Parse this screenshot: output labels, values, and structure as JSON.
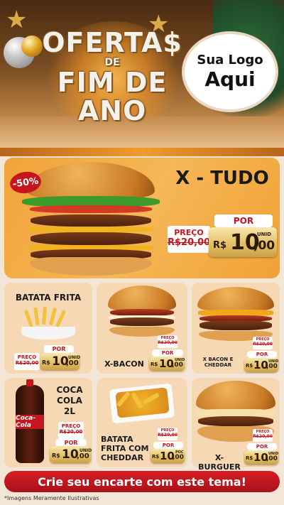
{
  "header": {
    "title_line1": "OFERTA$",
    "title_line2": "DE",
    "title_line3": "FIM DE ANO",
    "logo_line1": "Sua Logo",
    "logo_line2": "Aqui"
  },
  "currency": "R$",
  "unit_label": "UNID",
  "por_label": "POR",
  "preco_label": "PREÇO",
  "featured": {
    "name": "X - TUDO",
    "discount": "-50%",
    "old_price": "R$20,00",
    "price_int": "10",
    "price_dec": ",00"
  },
  "products": [
    {
      "name": "BATATA FRITA",
      "old_price": "R$20,00",
      "price_int": "10",
      "price_dec": ",00"
    },
    {
      "name": "X-BACON",
      "old_price": "R$20,00",
      "price_int": "10",
      "price_dec": ",00"
    },
    {
      "name": "X BACON E CHEDDAR",
      "old_price": "R$20,00",
      "price_int": "10",
      "price_dec": ",00"
    },
    {
      "name": "COCA COLA 2L",
      "old_price": "R$20,00",
      "price_int": "10",
      "price_dec": ",00",
      "unit": "UNID"
    },
    {
      "name": "BATATA FRITA COM CHEDDAR",
      "old_price": "R$20,00",
      "price_int": "10",
      "price_dec": ",00",
      "unit": "POC"
    },
    {
      "name": "X-BURGUER",
      "old_price": "R$20,00",
      "price_int": "10",
      "price_dec": ",00"
    }
  ],
  "bottle_brand": "Coca-Cola",
  "cta": "Crie seu encarte com este tema!",
  "footnote": "*Imagens Meramente Ilustrativas",
  "colors": {
    "primary_red": "#c4161c",
    "orange": "#f3a33a",
    "gold": "#e6c46c"
  }
}
